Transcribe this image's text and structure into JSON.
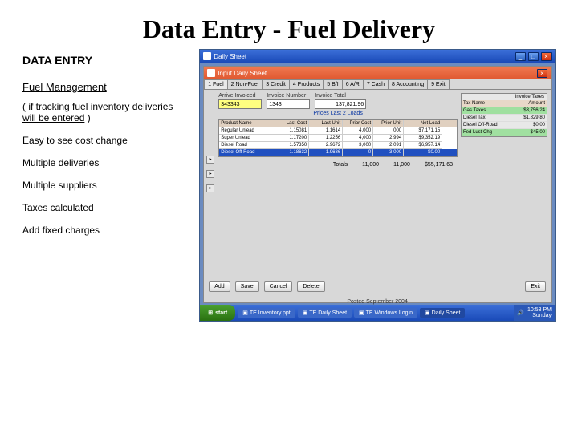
{
  "slide": {
    "title": "Data Entry - Fuel Delivery",
    "heading": "DATA ENTRY",
    "sub": "Fuel Management",
    "note_open": "( ",
    "note_u": "if tracking fuel inventory deliveries will be entered",
    "note_close": " )",
    "lines": [
      "Easy to see cost change",
      "Multiple deliveries",
      "Multiple suppliers",
      "Taxes calculated",
      "Add fixed charges"
    ]
  },
  "outer": {
    "title": "Daily Sheet"
  },
  "inner": {
    "title": "Input Daily Sheet"
  },
  "tabs": [
    "1 Fuel",
    "2 Non-Fuel",
    "3 Credit",
    "4 Products",
    "5 B/I",
    "6 A/R",
    "7 Cash",
    "8 Accounting",
    "9 Exit"
  ],
  "fields": {
    "arrive_lbl": "Arrive Invoiced",
    "arrive": "343343",
    "invno_lbl": "Invoice Number",
    "invno": "1343",
    "invtot_lbl": "Invoice Total",
    "invtot": "137,821.96"
  },
  "taxes": {
    "title": "Invoice Taxes",
    "hd": [
      "Tax Name",
      "Amount"
    ],
    "rows": [
      [
        "Gas Taxes",
        "$3,756.24"
      ],
      [
        "Diesel Tax",
        "$1,829.80"
      ],
      [
        "Diesel Off-Road",
        "$0.00"
      ],
      [
        "Fed Lust Chg",
        "$45.00"
      ]
    ]
  },
  "gridtitle": "Prices Last 2 Loads",
  "grid": {
    "hd": [
      "Product Name",
      "Last Cost",
      "Last Unit",
      "Prior Cost",
      "Prior Unit",
      "Net Load"
    ],
    "rows": [
      [
        "Regular Unlead",
        "1.15081",
        "1.1614",
        "4,000",
        ".000",
        "$7,171.15"
      ],
      [
        "Super Unlead",
        "1.17200",
        "1.2256",
        "4,000",
        "2,994",
        "$9,352.19"
      ],
      [
        "Diesel Road",
        "1.57350",
        "2.9672",
        "3,000",
        "2,091",
        "$6,957.14"
      ],
      [
        "Diesel Off Road",
        "1.18632",
        "1.9686",
        "0",
        "3,000",
        "$0.00"
      ]
    ]
  },
  "totals": {
    "lbl": "Totals",
    "v1": "11,000",
    "v2": "11,000",
    "v3": "$55,171.63"
  },
  "buttons": {
    "add": "Add",
    "save": "Save",
    "cancel": "Cancel",
    "delete": "Delete",
    "exit": "Exit"
  },
  "footer": "Posted September 2004",
  "task": {
    "start": "start",
    "items": [
      "TE Inventory.ppt",
      "TE Daily Sheet",
      "TE Windows Login",
      "Daily Sheet"
    ],
    "clock": "10:53 PM",
    "day": "Sunday"
  }
}
